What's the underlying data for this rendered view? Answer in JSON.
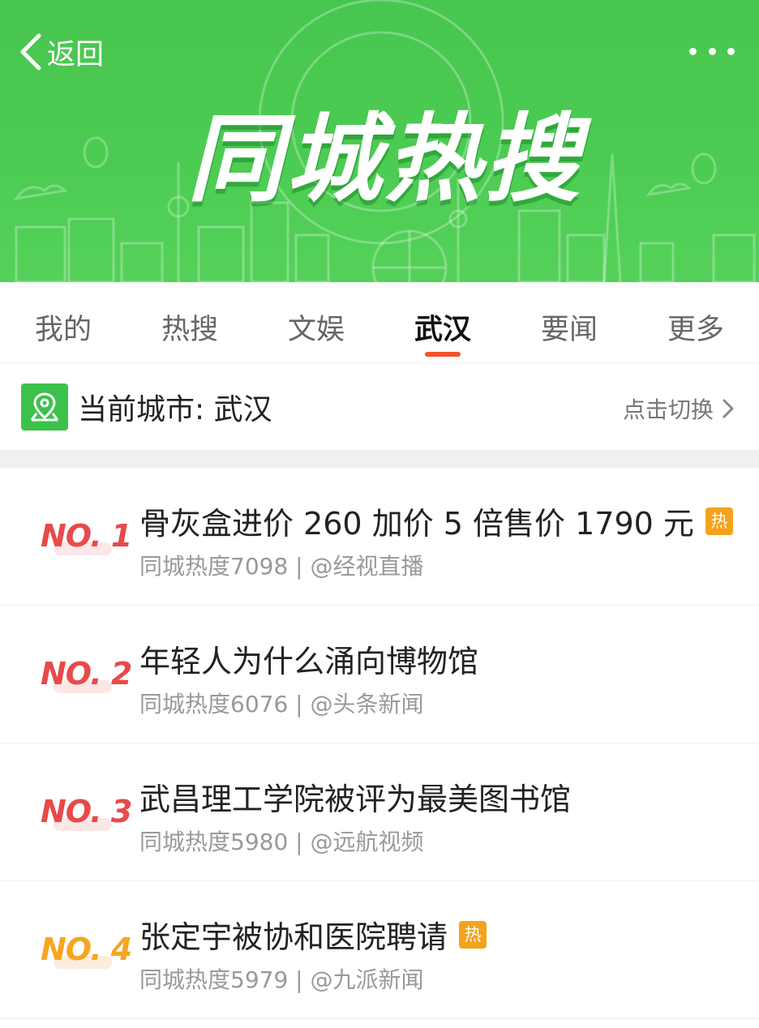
{
  "header": {
    "back_label": "返回",
    "title": "同城热搜"
  },
  "tabs": [
    {
      "label": "我的",
      "active": false
    },
    {
      "label": "热搜",
      "active": false
    },
    {
      "label": "文娱",
      "active": false
    },
    {
      "label": "武汉",
      "active": true
    },
    {
      "label": "要闻",
      "active": false
    },
    {
      "label": "更多",
      "active": false
    }
  ],
  "city": {
    "label": "当前城市: 武汉",
    "switch_label": "点击切换"
  },
  "list": [
    {
      "rank": "NO. 1",
      "title": "骨灰盒进价 260 加价 5 倍售价 1790 元",
      "hot": true,
      "hot_label": "热",
      "meta": "同城热度7098 | @经视直播",
      "rank_color": "#e84a4a"
    },
    {
      "rank": "NO. 2",
      "title": "年轻人为什么涌向博物馆",
      "hot": false,
      "meta": "同城热度6076 | @头条新闻",
      "rank_color": "#e84a4a"
    },
    {
      "rank": "NO. 3",
      "title": "武昌理工学院被评为最美图书馆",
      "hot": false,
      "meta": "同城热度5980 | @远航视频",
      "rank_color": "#e84a4a"
    },
    {
      "rank": "NO. 4",
      "title": "张定宇被协和医院聘请",
      "hot": true,
      "hot_label": "热",
      "meta": "同城热度5979 | @九派新闻",
      "rank_color": "#f5a623"
    }
  ],
  "colors": {
    "banner_green": "#4ccb52",
    "tab_indicator": "#f5522d",
    "hot_badge": "#f5a21b"
  }
}
